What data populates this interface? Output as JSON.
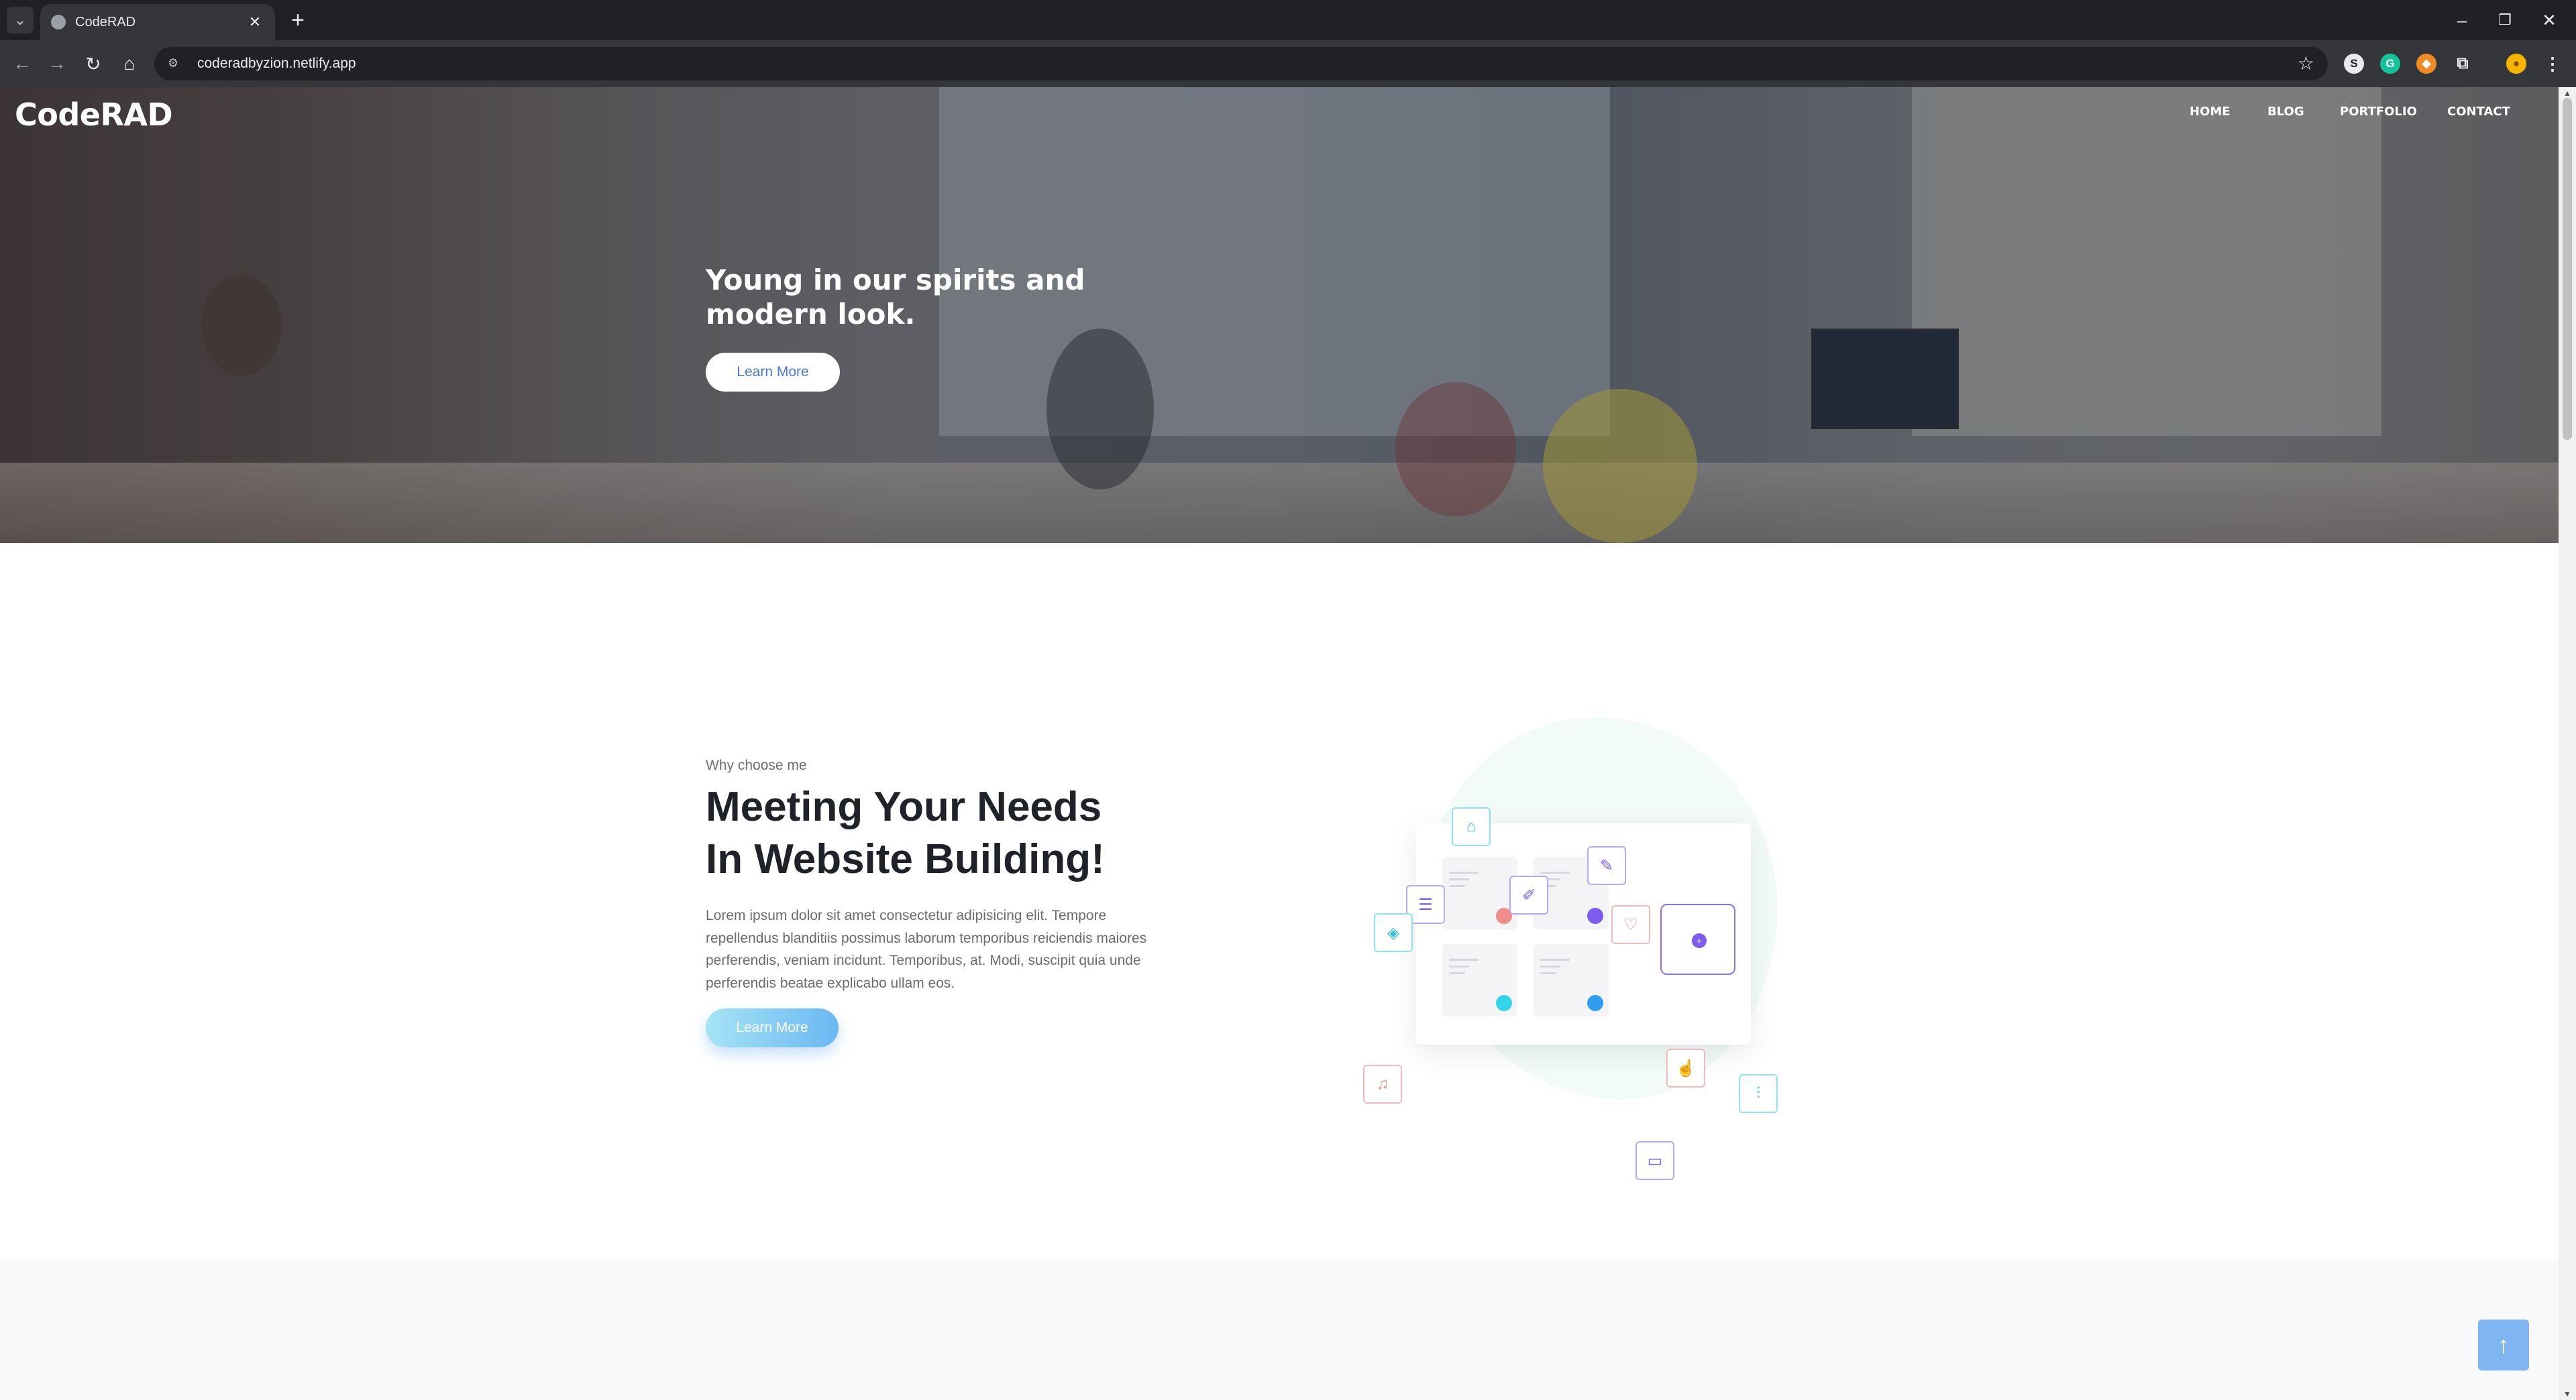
{
  "browser": {
    "tab_title": "CodeRAD",
    "new_tab_label": "+",
    "url": "coderadbyzion.netlify.app"
  },
  "site": {
    "logo": "CodeRAD",
    "nav": [
      "HOME",
      "BLOG",
      "PORTFOLIO",
      "CONTACT"
    ]
  },
  "hero": {
    "title_line1": "Young in our spirits and",
    "title_line2": "modern look.",
    "button": "Learn More"
  },
  "feature": {
    "eyebrow": "Why choose me",
    "title_line1": "Meeting Your Needs",
    "title_line2": "In Website Building!",
    "body": "Lorem ipsum dolor sit amet consectetur adipisicing elit. Tempore repellendus blanditiis possimus laborum temporibus reiciendis maiores perferendis, veniam incidunt. Temporibus, at. Modi, suscipit quia unde perferendis beatae explicabo ullam eos.",
    "button": "Learn More"
  },
  "colors": {
    "accent_blue": "#6bb8f2",
    "purple": "#7d5cf0",
    "pink": "#f08c8c",
    "cyan": "#34d4e8"
  }
}
